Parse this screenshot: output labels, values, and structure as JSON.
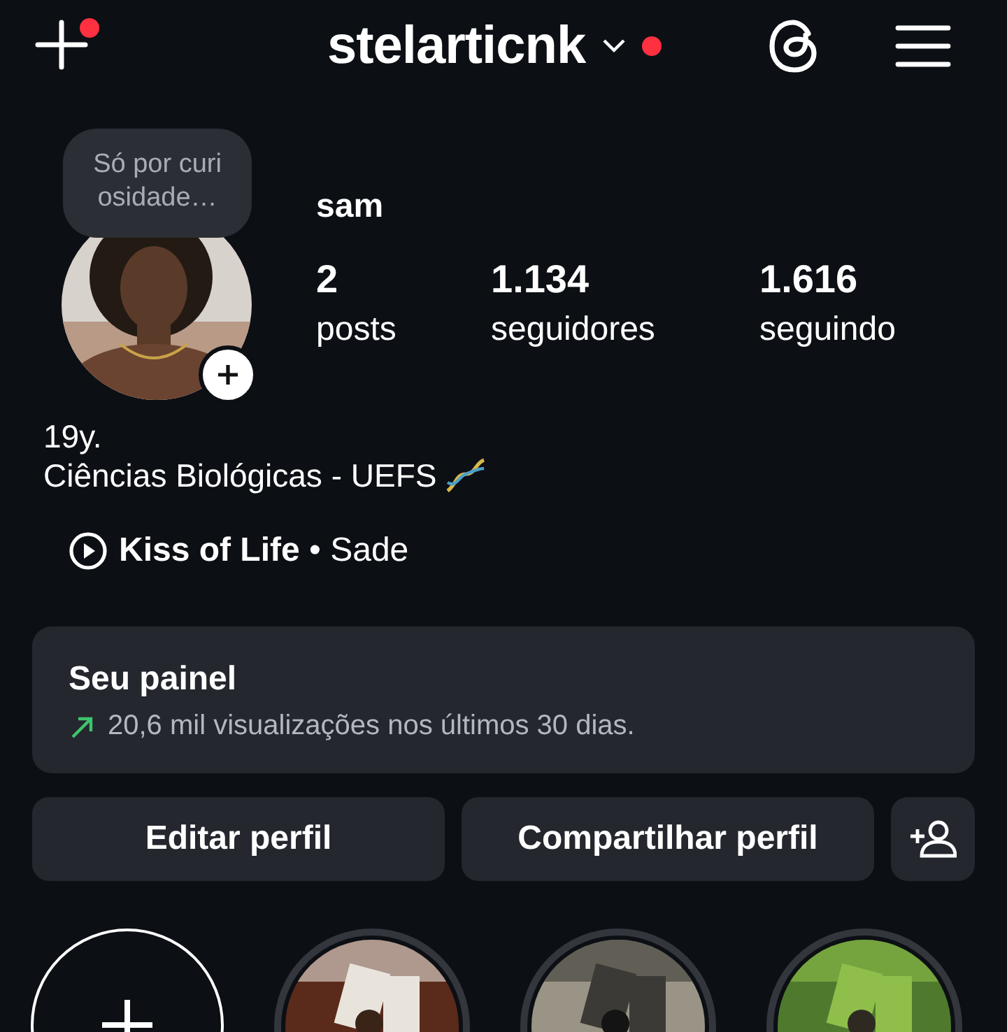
{
  "header": {
    "create_notification": true,
    "username": "stelarticnk",
    "username_notification": true
  },
  "profile": {
    "note": "Só por curiosidade…",
    "display_name": "sam",
    "stats": [
      {
        "value": "2",
        "label": "posts"
      },
      {
        "value": "1.134",
        "label": "seguidores"
      },
      {
        "value": "1.616",
        "label": "seguindo"
      }
    ]
  },
  "bio": {
    "lines": [
      "19y.",
      "Ciências Biológicas - UEFS"
    ],
    "music": "**Kiss of Life** • Sade"
  },
  "dashboard": {
    "title": "Seu painel",
    "subtitle": "20,6 mil visualizações nos últimos 30 dias."
  },
  "buttons": [
    "Editar perfil",
    "Compartilhar perfil"
  ],
  "highlights": [
    {
      "kind": "new"
    },
    {
      "kind": "picture"
    },
    {
      "kind": "picture"
    },
    {
      "kind": "picture"
    }
  ]
}
